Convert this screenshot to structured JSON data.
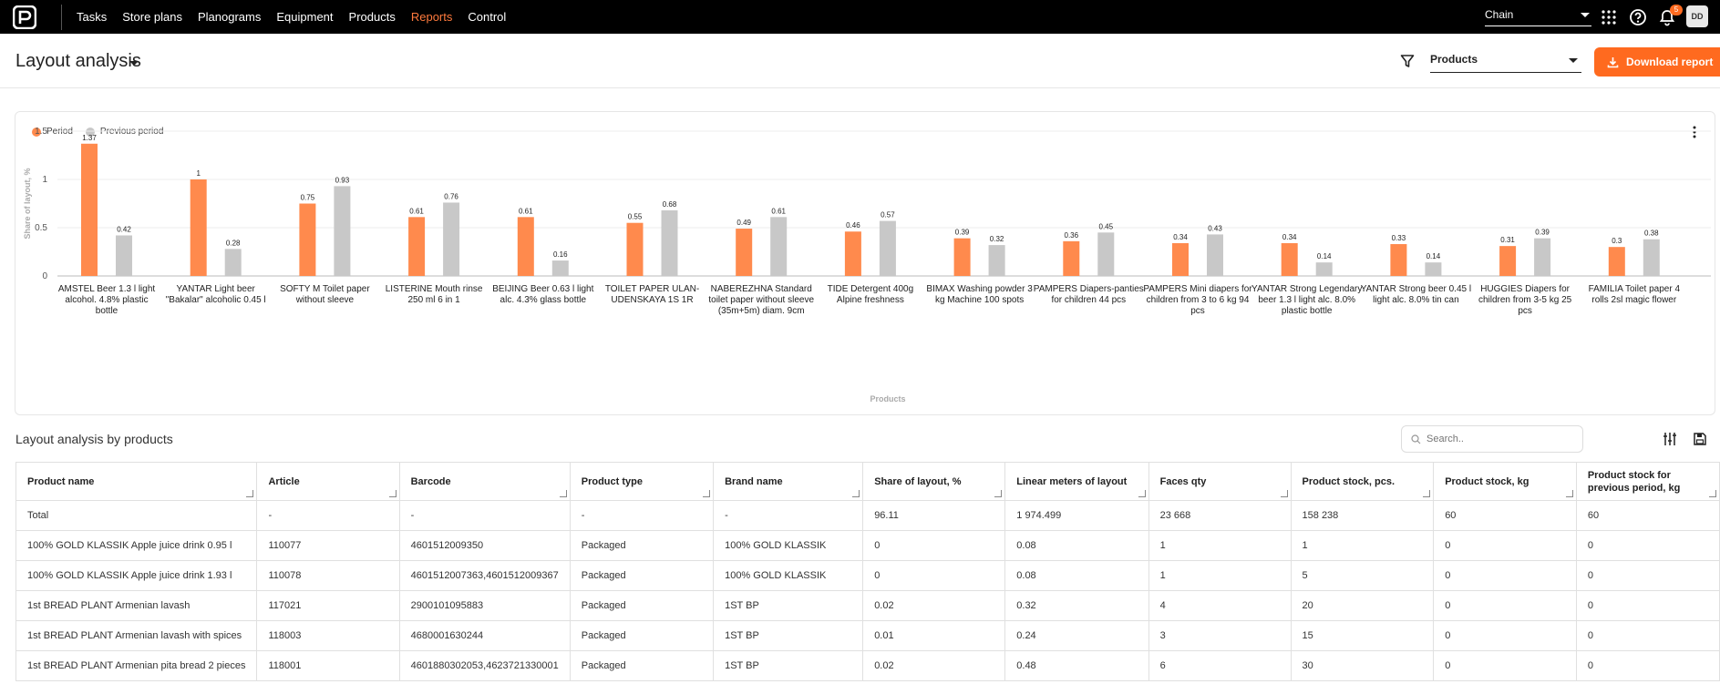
{
  "topnav": {
    "items": [
      {
        "label": "Tasks",
        "active": false
      },
      {
        "label": "Store plans",
        "active": false
      },
      {
        "label": "Planograms",
        "active": false
      },
      {
        "label": "Equipment",
        "active": false
      },
      {
        "label": "Products",
        "active": false
      },
      {
        "label": "Reports",
        "active": true
      },
      {
        "label": "Control",
        "active": false
      }
    ],
    "chain_select": "Chain",
    "notifications_count": "5",
    "avatar": "DD",
    "accent": "#ff7a3d"
  },
  "header": {
    "title": "Layout analysis",
    "products_select": "Products",
    "download_label": "Download report"
  },
  "chart_data": {
    "type": "bar",
    "legend": [
      "Period",
      "Previous period"
    ],
    "legend_position": "top-left",
    "colors": {
      "Period": "#ff8a4d",
      "Previous period": "#c8c8c8"
    },
    "ylabel": "Share of layout, %",
    "xlabel": "Products",
    "ylim": [
      0,
      1.5
    ],
    "yticks": [
      "1.5",
      "1",
      "0.5",
      "0"
    ],
    "grid": true,
    "categories": [
      [
        "AMSTEL Beer 1.3 l light",
        "alcohol. 4.8% plastic",
        "bottle"
      ],
      [
        "YANTAR Light beer",
        "\"Bakalar\" alcoholic 0.45 l"
      ],
      [
        "SOFTY M Toilet paper",
        "without sleeve"
      ],
      [
        "LISTERINE Mouth rinse",
        "250 ml 6 in 1"
      ],
      [
        "BEIJING Beer 0.63 l light",
        "alc. 4.3% glass bottle"
      ],
      [
        "TOILET PAPER ULAN-",
        "UDENSKAYA 1S 1R"
      ],
      [
        "NABEREZHNA Standard",
        "toilet paper without sleeve",
        "(35m+5m) diam. 9cm"
      ],
      [
        "TIDE Detergent 400g",
        "Alpine freshness"
      ],
      [
        "BIMAX Washing powder 3",
        "kg Machine 100 spots"
      ],
      [
        "PAMPERS Diapers-panties",
        "for children 44 pcs"
      ],
      [
        "PAMPERS Mini diapers for",
        "children from 3 to 6 kg 94",
        "pcs"
      ],
      [
        "YANTAR Strong Legendary",
        "beer 1.3 l light alc. 8.0%",
        "plastic bottle"
      ],
      [
        "YANTAR Strong beer 0.45 l",
        "light alc. 8.0% tin can"
      ],
      [
        "HUGGIES Diapers for",
        "children from 3-5 kg 25",
        "pcs"
      ],
      [
        "FAMILIA Toilet paper 4",
        "rolls 2sl magic flower"
      ]
    ],
    "series": [
      {
        "name": "Period",
        "values": [
          1.37,
          1,
          0.75,
          0.61,
          0.61,
          0.55,
          0.49,
          0.46,
          0.39,
          0.36,
          0.34,
          0.34,
          0.33,
          0.31,
          0.3
        ]
      },
      {
        "name": "Previous period",
        "values": [
          0.42,
          0.28,
          0.93,
          0.76,
          0.16,
          0.68,
          0.61,
          0.57,
          0.32,
          0.45,
          0.43,
          0.14,
          0.14,
          0.39,
          0.38
        ]
      }
    ]
  },
  "table_section": {
    "title": "Layout analysis by products",
    "search_placeholder": "Search.."
  },
  "table": {
    "columns": [
      "Product name",
      "Article",
      "Barcode",
      "Product type",
      "Brand name",
      "Share of layout, %",
      "Linear meters of layout",
      "Faces qty",
      "Product stock, pcs.",
      "Product stock, kg",
      "Product stock for previous period, kg"
    ],
    "rows": [
      [
        "Total",
        "-",
        "-",
        "-",
        "-",
        "96.11",
        "1 974.499",
        "23 668",
        "158 238",
        "60",
        "60"
      ],
      [
        "100% GOLD KLASSIK Apple juice drink 0.95 l",
        "110077",
        "4601512009350",
        "Packaged",
        "100% GOLD KLASSIK",
        "0",
        "0.08",
        "1",
        "1",
        "0",
        "0"
      ],
      [
        "100% GOLD KLASSIK Apple juice drink 1.93 l",
        "110078",
        "4601512007363,4601512009367",
        "Packaged",
        "100% GOLD KLASSIK",
        "0",
        "0.08",
        "1",
        "5",
        "0",
        "0"
      ],
      [
        "1st BREAD PLANT Armenian lavash",
        "117021",
        "2900101095883",
        "Packaged",
        "1ST BP",
        "0.02",
        "0.32",
        "4",
        "20",
        "0",
        "0"
      ],
      [
        "1st BREAD PLANT Armenian lavash with spices",
        "118003",
        "4680001630244",
        "Packaged",
        "1ST BP",
        "0.01",
        "0.24",
        "3",
        "15",
        "0",
        "0"
      ],
      [
        "1st BREAD PLANT Armenian pita bread 2 pieces",
        "118001",
        "4601880302053,4623721330001",
        "Packaged",
        "1ST BP",
        "0.02",
        "0.48",
        "6",
        "30",
        "0",
        "0"
      ]
    ]
  }
}
